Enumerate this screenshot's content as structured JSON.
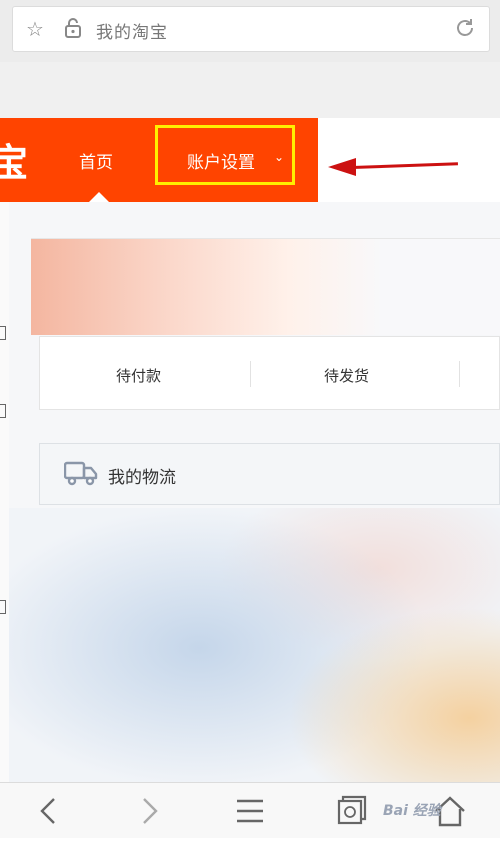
{
  "address_bar": {
    "title": "我的淘宝",
    "icons": [
      "star-icon",
      "lock-icon",
      "refresh-icon"
    ]
  },
  "nav": {
    "logo_char": "宝",
    "home_label": "首页",
    "account_label": "账户设置",
    "caret": "⌄",
    "bg_color": "#ff4400",
    "highlight_color": "#ffef00"
  },
  "annotation": {
    "arrow_color": "#cc1111"
  },
  "orders": {
    "tabs": [
      "待付款",
      "待发货"
    ]
  },
  "logistics": {
    "label": "我的物流",
    "icon": "truck-icon"
  },
  "toolbar": {
    "icons": [
      "back-icon",
      "forward-icon",
      "menu-icon",
      "tabs-icon",
      "home-icon"
    ]
  },
  "watermark": "Bai 经验"
}
